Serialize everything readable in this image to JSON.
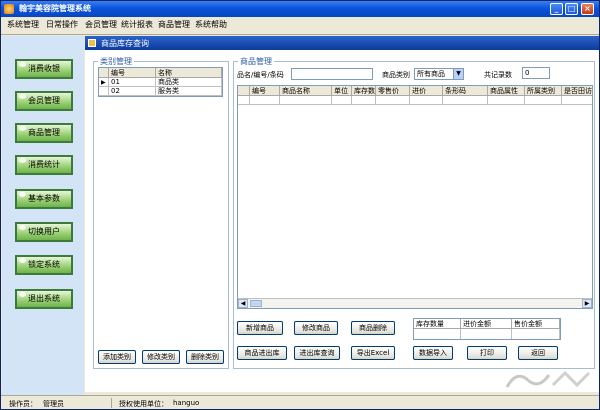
{
  "window": {
    "title": "翰宇美容院管理系统",
    "minimize": "_",
    "maximize": "□",
    "close": "×"
  },
  "menu": [
    "系统管理",
    "日常操作",
    "会员管理",
    "统计报表",
    "商品管理",
    "系统帮助"
  ],
  "sidebar": [
    "消费收银",
    "会员管理",
    "商品管理",
    "消费统计",
    "基本参数",
    "切换用户",
    "锁定系统",
    "退出系统"
  ],
  "form": {
    "title": "商品库存查询"
  },
  "category": {
    "group_label": "类别管理",
    "columns": [
      "编号",
      "名称"
    ],
    "rows": [
      [
        "01",
        "商品类"
      ],
      [
        "02",
        "服务类"
      ]
    ],
    "buttons": [
      "添加类别",
      "修改类别",
      "删除类别"
    ]
  },
  "goods": {
    "group_label": "商品管理",
    "search_label": "品名/编号/条码",
    "search_value": "",
    "type_label": "商品类别",
    "type_value": "所有商品",
    "count_label": "共记录数",
    "count_value": "0",
    "columns": [
      "编号",
      "商品名称",
      "单位",
      "库存数",
      "零售价",
      "进价",
      "条形码",
      "商品属性",
      "所属类别",
      "是否田访"
    ],
    "buttons_row1": [
      "新增商品",
      "修改商品",
      "商品删除"
    ],
    "buttons_row2": [
      "商品进出库",
      "进出库查询",
      "导出Excel",
      "数据导入",
      "打印",
      "返回"
    ],
    "summary_headers": [
      "库存数量",
      "进价金额",
      "售价金额"
    ]
  },
  "status": {
    "operator_label": "操作员：",
    "operator": "管理员",
    "licensee_label": "授权使用单位：",
    "licensee": "hanguo"
  }
}
